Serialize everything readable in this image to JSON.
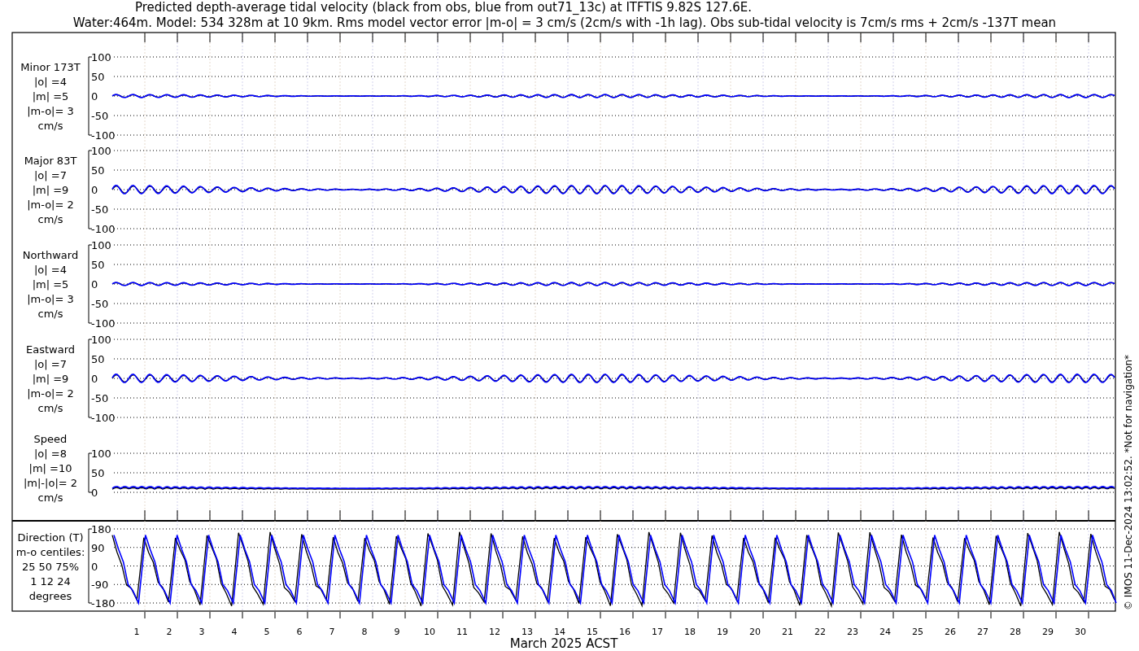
{
  "title_lines": [
    "Predicted depth-average tidal velocity (black from obs, blue from out71_13c) at ITFTIS 9.82S 127.6E.",
    "Water:464m. Model: 534 328m at 10 9km. Rms model vector error |m-o| = 3 cm/s (2cm/s with -1h lag). Obs sub-tidal velocity is 7cm/s rms + 2cm/s -137T mean"
  ],
  "panels": [
    {
      "kind": "velocity",
      "label_lines": [
        "Minor 173T",
        "|o| =4",
        "|m| =5",
        "|m-o|= 3",
        "cm/s"
      ],
      "yticks": [
        "100",
        "50",
        "0",
        "-50",
        "-100"
      ]
    },
    {
      "kind": "velocity",
      "label_lines": [
        "Major 83T",
        "|o| =7",
        "|m| =9",
        "|m-o|= 2",
        "cm/s"
      ],
      "yticks": [
        "100",
        "50",
        "0",
        "-50",
        "-100"
      ]
    },
    {
      "kind": "velocity",
      "label_lines": [
        "Northward",
        "|o| =4",
        "|m| =5",
        "|m-o|= 3",
        "cm/s"
      ],
      "yticks": [
        "100",
        "50",
        "0",
        "-50",
        "-100"
      ]
    },
    {
      "kind": "velocity",
      "label_lines": [
        "Eastward",
        "|o| =7",
        "|m| =9",
        "|m-o|= 2",
        "cm/s"
      ],
      "yticks": [
        "100",
        "50",
        "0",
        "-50",
        "-100"
      ]
    },
    {
      "kind": "speed",
      "label_lines": [
        "Speed",
        "|o| =8",
        "|m| =10",
        "|m|-|o|= 2",
        "cm/s"
      ],
      "yticks": [
        "100",
        "50",
        "0"
      ]
    },
    {
      "kind": "direction",
      "label_lines": [
        "Direction (T)",
        "m-o centiles:",
        "25  50  75%",
        "1  12  24",
        "degrees"
      ],
      "yticks": [
        "180",
        "90",
        "0",
        "-90",
        "-180"
      ]
    }
  ],
  "days": [
    "1",
    "2",
    "3",
    "4",
    "5",
    "6",
    "7",
    "8",
    "9",
    "10",
    "11",
    "12",
    "13",
    "14",
    "15",
    "16",
    "17",
    "18",
    "19",
    "20",
    "21",
    "22",
    "23",
    "24",
    "25",
    "26",
    "27",
    "28",
    "29",
    "30"
  ],
  "xlabel": "March 2025 ACST",
  "credit": "© IMOS 11-Dec-2024 13:02:52. *Not for navigation*"
}
